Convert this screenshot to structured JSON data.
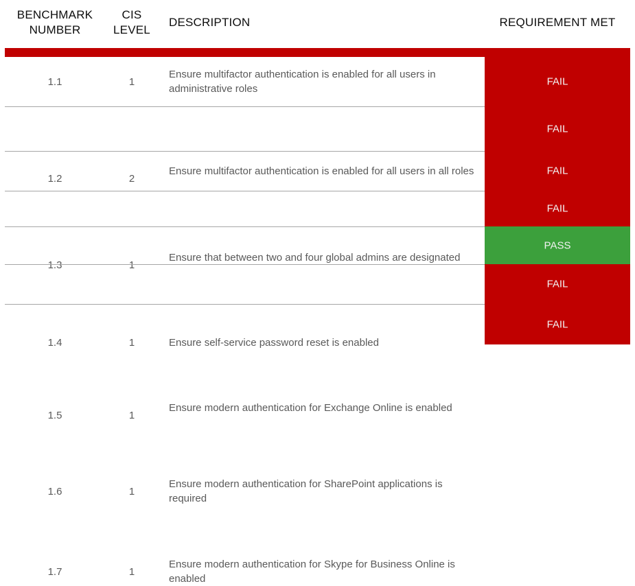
{
  "table": {
    "columns": [
      {
        "key": "benchmark_number",
        "label": "BENCHMARK\nNUMBER"
      },
      {
        "key": "cis_level",
        "label": "CIS\nLEVEL"
      },
      {
        "key": "description",
        "label": "DESCRIPTION"
      },
      {
        "key": "requirement_met",
        "label": "REQUIREMENT MET"
      }
    ],
    "colors": {
      "accent_red": "#C00000",
      "pass_green": "#3CA03C",
      "fail_red": "#C00000",
      "rule_gray": "#A6A6A6",
      "body_text": "#595959",
      "header_text": "#0D0D0D",
      "status_text": "#F2F2F2"
    },
    "rows": [
      {
        "benchmark_number": "1.1",
        "cis_level": "1",
        "description": "Ensure multifactor authentication is enabled for all users in administrative roles",
        "requirement_met": "FAIL",
        "status": "fail"
      },
      {
        "benchmark_number": "1.2",
        "cis_level": "2",
        "description": "Ensure multifactor authentication is enabled for all users in all roles",
        "requirement_met": "FAIL",
        "status": "fail"
      },
      {
        "benchmark_number": "1.3",
        "cis_level": "1",
        "description": "Ensure that between two and four global admins are designated",
        "requirement_met": "FAIL",
        "status": "fail"
      },
      {
        "benchmark_number": "1.4",
        "cis_level": "1",
        "description": "Ensure self-service password reset is enabled",
        "requirement_met": "FAIL",
        "status": "fail"
      },
      {
        "benchmark_number": "1.5",
        "cis_level": "1",
        "description": "Ensure modern authentication for Exchange Online is enabled",
        "requirement_met": "PASS",
        "status": "pass"
      },
      {
        "benchmark_number": "1.6",
        "cis_level": "1",
        "description": "Ensure modern authentication for SharePoint applications is required",
        "requirement_met": "FAIL",
        "status": "fail"
      },
      {
        "benchmark_number": "1.7",
        "cis_level": "1",
        "description": "Ensure modern authentication for Skype for Business Online is enabled",
        "requirement_met": "FAIL",
        "status": "fail"
      }
    ]
  }
}
